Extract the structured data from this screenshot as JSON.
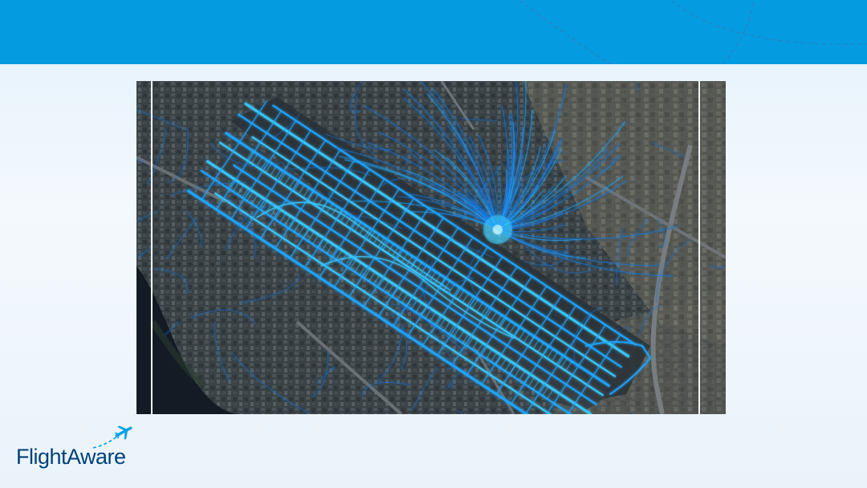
{
  "slide": {
    "header_color": "#049be1",
    "accent_track_color": "#00c8ff",
    "map_image": {
      "subject": "satellite-view-airport-runways-with-flight-tracks",
      "track_color": "#22a8ff"
    },
    "logo": {
      "text": "FlightAware",
      "text_color": "#00417a",
      "plane_color": "#00a0e4",
      "icon": "airplane-icon"
    }
  }
}
